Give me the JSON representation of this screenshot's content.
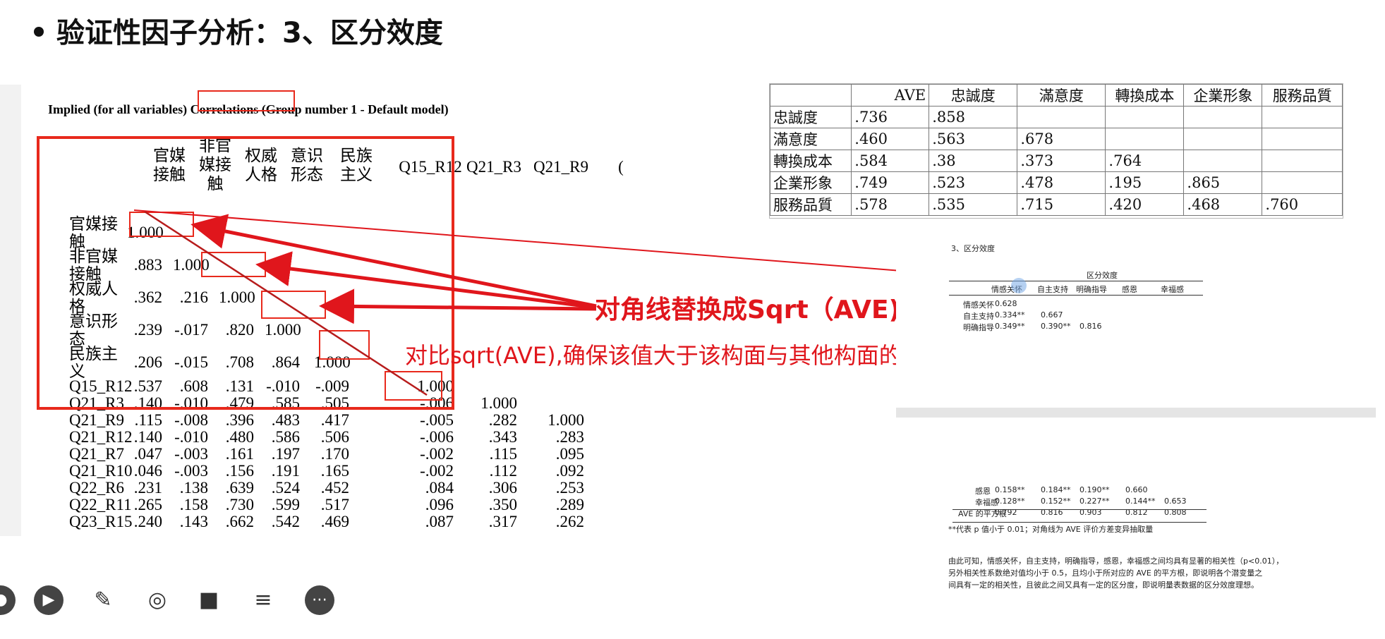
{
  "slide": {
    "title": "验证性因子分析：3、区分效度",
    "annotation_main": "对角线替换成Sqrt（AVE)",
    "annotation_sub": "对比sqrt(AVE),确保该值大于该构面与其他构面的相关系数"
  },
  "amos": {
    "heading": "Implied (for all variables) Correlations (Group number 1 - Default model)",
    "columns": [
      "官媒\n接触",
      "非官\n媒接\n触",
      "权威\n人格",
      "意识\n形态",
      "民族\n主义",
      "Q15_R12",
      "Q21_R3",
      "Q21_R9",
      "("
    ],
    "rows": [
      {
        "label": "官媒接\n触",
        "values": [
          "1.000",
          "",
          "",
          "",
          "",
          "",
          "",
          ""
        ]
      },
      {
        "label": "非官媒\n接触",
        "values": [
          ".883",
          "1.000",
          "",
          "",
          "",
          "",
          "",
          ""
        ]
      },
      {
        "label": "权威人\n格",
        "values": [
          ".362",
          ".216",
          "1.000",
          "",
          "",
          "",
          "",
          ""
        ]
      },
      {
        "label": "意识形\n态",
        "values": [
          ".239",
          "-.017",
          ".820",
          "1.000",
          "",
          "",
          "",
          ""
        ]
      },
      {
        "label": "民族主\n义",
        "values": [
          ".206",
          "-.015",
          ".708",
          ".864",
          "1.000",
          "",
          "",
          ""
        ]
      },
      {
        "label": "Q15_R12",
        "values": [
          ".537",
          ".608",
          ".131",
          "-.010",
          "-.009",
          "1.000",
          "",
          ""
        ]
      },
      {
        "label": "Q21_R3",
        "values": [
          ".140",
          "-.010",
          ".479",
          ".585",
          ".505",
          "-.006",
          "1.000",
          ""
        ]
      },
      {
        "label": "Q21_R9",
        "values": [
          ".115",
          "-.008",
          ".396",
          ".483",
          ".417",
          "-.005",
          ".282",
          "1.000"
        ]
      },
      {
        "label": "Q21_R12",
        "values": [
          ".140",
          "-.010",
          ".480",
          ".586",
          ".506",
          "-.006",
          ".343",
          ".283"
        ]
      },
      {
        "label": "Q21_R7",
        "values": [
          ".047",
          "-.003",
          ".161",
          ".197",
          ".170",
          "-.002",
          ".115",
          ".095"
        ]
      },
      {
        "label": "Q21_R10",
        "values": [
          ".046",
          "-.003",
          ".156",
          ".191",
          ".165",
          "-.002",
          ".112",
          ".092"
        ]
      },
      {
        "label": "Q22_R6",
        "values": [
          ".231",
          ".138",
          ".639",
          ".524",
          ".452",
          ".084",
          ".306",
          ".253"
        ]
      },
      {
        "label": "Q22_R11",
        "values": [
          ".265",
          ".158",
          ".730",
          ".599",
          ".517",
          ".096",
          ".350",
          ".289"
        ]
      },
      {
        "label": "Q23_R15",
        "values": [
          ".240",
          ".143",
          ".662",
          ".542",
          ".469",
          ".087",
          ".317",
          ".262"
        ]
      }
    ]
  },
  "ave_table": {
    "headers": [
      "",
      "AVE",
      "忠誠度",
      "滿意度",
      "轉換成本",
      "企業形象",
      "服務品質"
    ],
    "rows": [
      [
        "忠誠度",
        ".736",
        ".858",
        "",
        "",
        "",
        ""
      ],
      [
        "滿意度",
        ".460",
        ".563",
        ".678",
        "",
        "",
        ""
      ],
      [
        "轉換成本",
        ".584",
        ".38",
        ".373",
        ".764",
        "",
        ""
      ],
      [
        "企業形象",
        ".749",
        ".523",
        ".478",
        ".195",
        ".865",
        ""
      ],
      [
        "服務品質",
        ".578",
        ".535",
        ".715",
        ".420",
        ".468",
        ".760"
      ]
    ]
  },
  "doc": {
    "section": "3、区分效度",
    "caption": "区分效度",
    "head": [
      "",
      "情感关怀",
      "自主支持",
      "明确指导",
      "感恩",
      "幸福感"
    ],
    "top_rows": [
      [
        "情感关怀",
        "0.628",
        "",
        "",
        "",
        ""
      ],
      [
        "自主支持",
        "0.334**",
        "0.667",
        "",
        "",
        ""
      ],
      [
        "明确指导",
        "0.349**",
        "0.390**",
        "0.816",
        "",
        ""
      ]
    ],
    "bottom_rows": [
      [
        "感恩",
        "0.158**",
        "0.184**",
        "0.190**",
        "0.660",
        ""
      ],
      [
        "幸福感",
        "0.128**",
        "0.152**",
        "0.227**",
        "0.144**",
        "0.653"
      ],
      [
        "AVE 的平方根",
        "0.792",
        "0.816",
        "0.903",
        "0.812",
        "0.808"
      ]
    ],
    "footnote": "**代表 p 值小于 0.01；对角线为 AVE 评价方差变异抽取量",
    "para1": "由此可知，情感关怀，自主支持，明确指导，感恩，幸福感之间均具有显著的相关性（p<0.01），",
    "para2": "另外相关性系数绝对值均小于 0.5，且均小于所对应的 AVE 的平方根，即说明各个潜变量之",
    "para3": "间具有一定的相关性，且彼此之间又具有一定的区分度，即说明量表数据的区分效度理想。"
  },
  "toolbar": {
    "icons": [
      "record-icon",
      "play-icon",
      "pen-icon",
      "screenshot-icon",
      "camera-icon",
      "comment-icon",
      "more-icon"
    ]
  }
}
